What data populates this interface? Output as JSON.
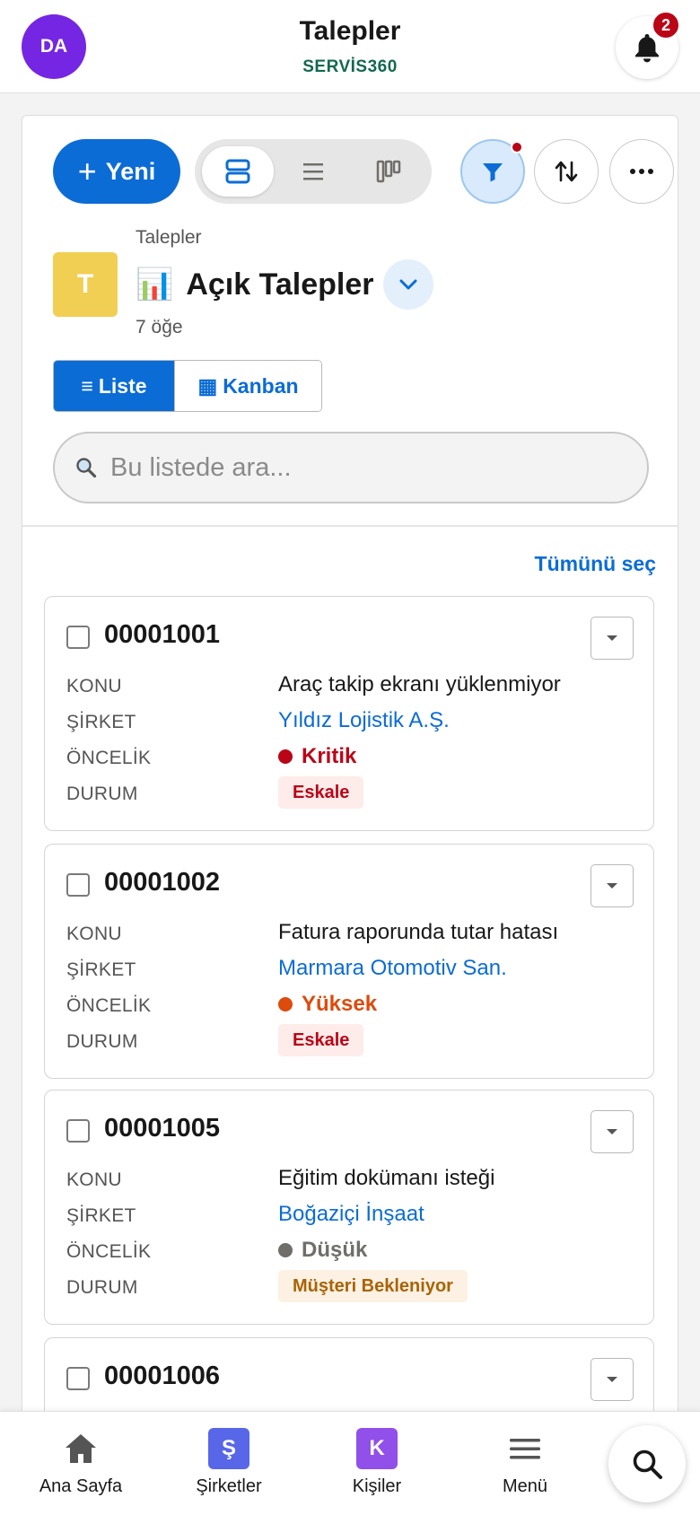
{
  "header": {
    "avatar_initials": "DA",
    "title": "Talepler",
    "brand": "SERVİS360",
    "notification_count": "2"
  },
  "toolbar": {
    "new_label": "Yeni",
    "view_modes": [
      "card-view-icon",
      "list-view-icon",
      "board-view-icon"
    ],
    "active_view_mode": "card-view-icon",
    "filter_active": true,
    "buttons": [
      "filter-icon",
      "sort-icon",
      "more-icon"
    ]
  },
  "list": {
    "breadcrumb": "Talepler",
    "object_initial": "T",
    "title_emoji": "📊",
    "title": "Açık Talepler",
    "count": "7 öğe",
    "toggle": {
      "list_label": "Liste",
      "list_icon": "≡",
      "kanban_label": "Kanban",
      "kanban_icon": "▦",
      "active": "list"
    },
    "search_placeholder": "Bu listede ara...",
    "select_all": "Tümünü seç"
  },
  "field_labels": {
    "subject": "KONU",
    "company": "ŞİRKET",
    "priority": "ÖNCELİK",
    "status": "DURUM"
  },
  "records": [
    {
      "number": "00001001",
      "subject": "Araç takip ekranı yüklenmiyor",
      "company": "Yıldız Lojistik A.Ş.",
      "priority": "Kritik",
      "priority_color": "#ba0517",
      "status": "Eskale",
      "status_color": "#ba0517",
      "status_bg": "#fdecea"
    },
    {
      "number": "00001002",
      "subject": "Fatura raporunda tutar hatası",
      "company": "Marmara Otomotiv San.",
      "priority": "Yüksek",
      "priority_color": "#dd4b0d",
      "status": "Eskale",
      "status_color": "#ba0517",
      "status_bg": "#fdecea"
    },
    {
      "number": "00001005",
      "subject": "Eğitim dokümanı isteği",
      "company": "Boğaziçi İnşaat",
      "priority": "Düşük",
      "priority_color": "#706e6b",
      "status": "Müşteri Bekleniyor",
      "status_color": "#a96404",
      "status_bg": "#fdf1e4"
    },
    {
      "number": "00001006"
    }
  ],
  "bottom_nav": {
    "items": [
      {
        "label": "Ana Sayfa",
        "icon": "home-icon"
      },
      {
        "label": "Şirketler",
        "icon": "company-tile-icon",
        "tile_letter": "Ş",
        "tile_color": "#5867e8"
      },
      {
        "label": "Kişiler",
        "icon": "contact-tile-icon",
        "tile_letter": "K",
        "tile_color": "#9050e9"
      },
      {
        "label": "Menü",
        "icon": "menu-icon"
      }
    ],
    "search_icon": "search-icon"
  },
  "colors": {
    "brand_blue": "#0b6cd6",
    "brand_green": "#13694f",
    "avatar_purple": "#7526e3",
    "alert_red": "#ba0517",
    "object_yellow": "#f1cf53"
  }
}
